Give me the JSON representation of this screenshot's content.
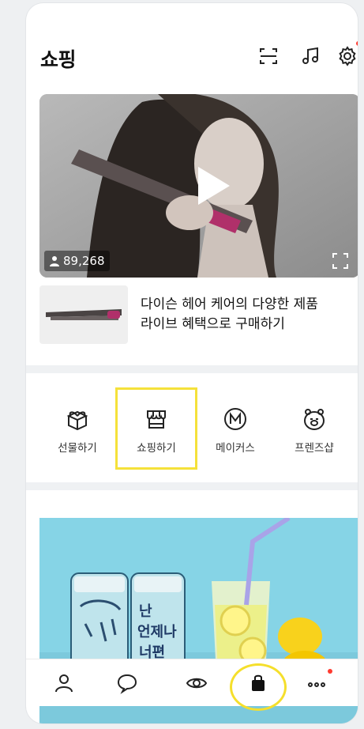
{
  "header": {
    "title": "쇼핑",
    "icons": [
      "scan-icon",
      "music-icon",
      "settings-icon"
    ]
  },
  "live": {
    "viewer_count": "89,268",
    "product_line1": "다이슨 헤어 케어의 다양한 제품",
    "product_line2": "라이브 혜택으로 구매하기"
  },
  "menu": [
    {
      "label": "선물하기",
      "icon": "gift-icon"
    },
    {
      "label": "쇼핑하기",
      "icon": "store-icon"
    },
    {
      "label": "메이커스",
      "icon": "makers-icon"
    },
    {
      "label": "프렌즈샵",
      "icon": "friends-shop-icon"
    }
  ],
  "banner": {
    "can_text_1": "난",
    "can_text_2": "언제나",
    "can_text_3": "너편"
  },
  "bottom_nav": [
    "friends-icon",
    "chat-icon",
    "view-icon",
    "shopping-icon",
    "more-icon"
  ],
  "colors": {
    "highlight": "#f5e13a",
    "notification": "#ff3b30",
    "banner_bg": "#86d4e6"
  }
}
